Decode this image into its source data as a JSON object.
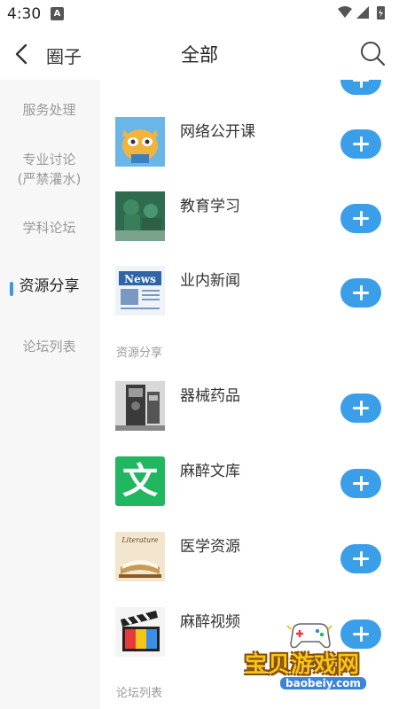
{
  "status_bar": {
    "time": "4:30",
    "notification_badge": "A",
    "icons": [
      "wifi-icon",
      "signal-icon",
      "battery-icon"
    ]
  },
  "header": {
    "back_label": "圈子",
    "title": "全部"
  },
  "sidebar": {
    "items": [
      {
        "label": "服务处理",
        "active": false
      },
      {
        "label": "专业讨论",
        "label2": "(严禁灌水)",
        "active": false
      },
      {
        "label": "学科论坛",
        "active": false
      },
      {
        "label": "资源分享",
        "active": true
      },
      {
        "label": "论坛列表",
        "active": false
      }
    ]
  },
  "content": {
    "forums": [
      {
        "label": "网络公开课",
        "icon": "cartoon-mascot-icon"
      },
      {
        "label": "教育学习",
        "icon": "surgery-photo-icon"
      },
      {
        "label": "业内新闻",
        "icon": "news-icon",
        "icon_text": "News"
      }
    ],
    "section_resource_title": "资源分享",
    "resources": [
      {
        "label": "器械药品",
        "icon": "medical-machine-icon"
      },
      {
        "label": "麻醉文库",
        "icon": "wen-library-icon",
        "icon_text": "文"
      },
      {
        "label": "医学资源",
        "icon": "literature-book-icon",
        "icon_text": "Literature"
      },
      {
        "label": "麻醉视频",
        "icon": "film-clapper-icon"
      }
    ],
    "section_forum_list_title": "论坛列表"
  },
  "watermark": {
    "title": "宝贝游戏网",
    "url": "baobeiy.com"
  },
  "colors": {
    "accent": "#3a9fe8",
    "indicator": "#3a97ea",
    "sidebar_bg": "#f7f7f7"
  }
}
